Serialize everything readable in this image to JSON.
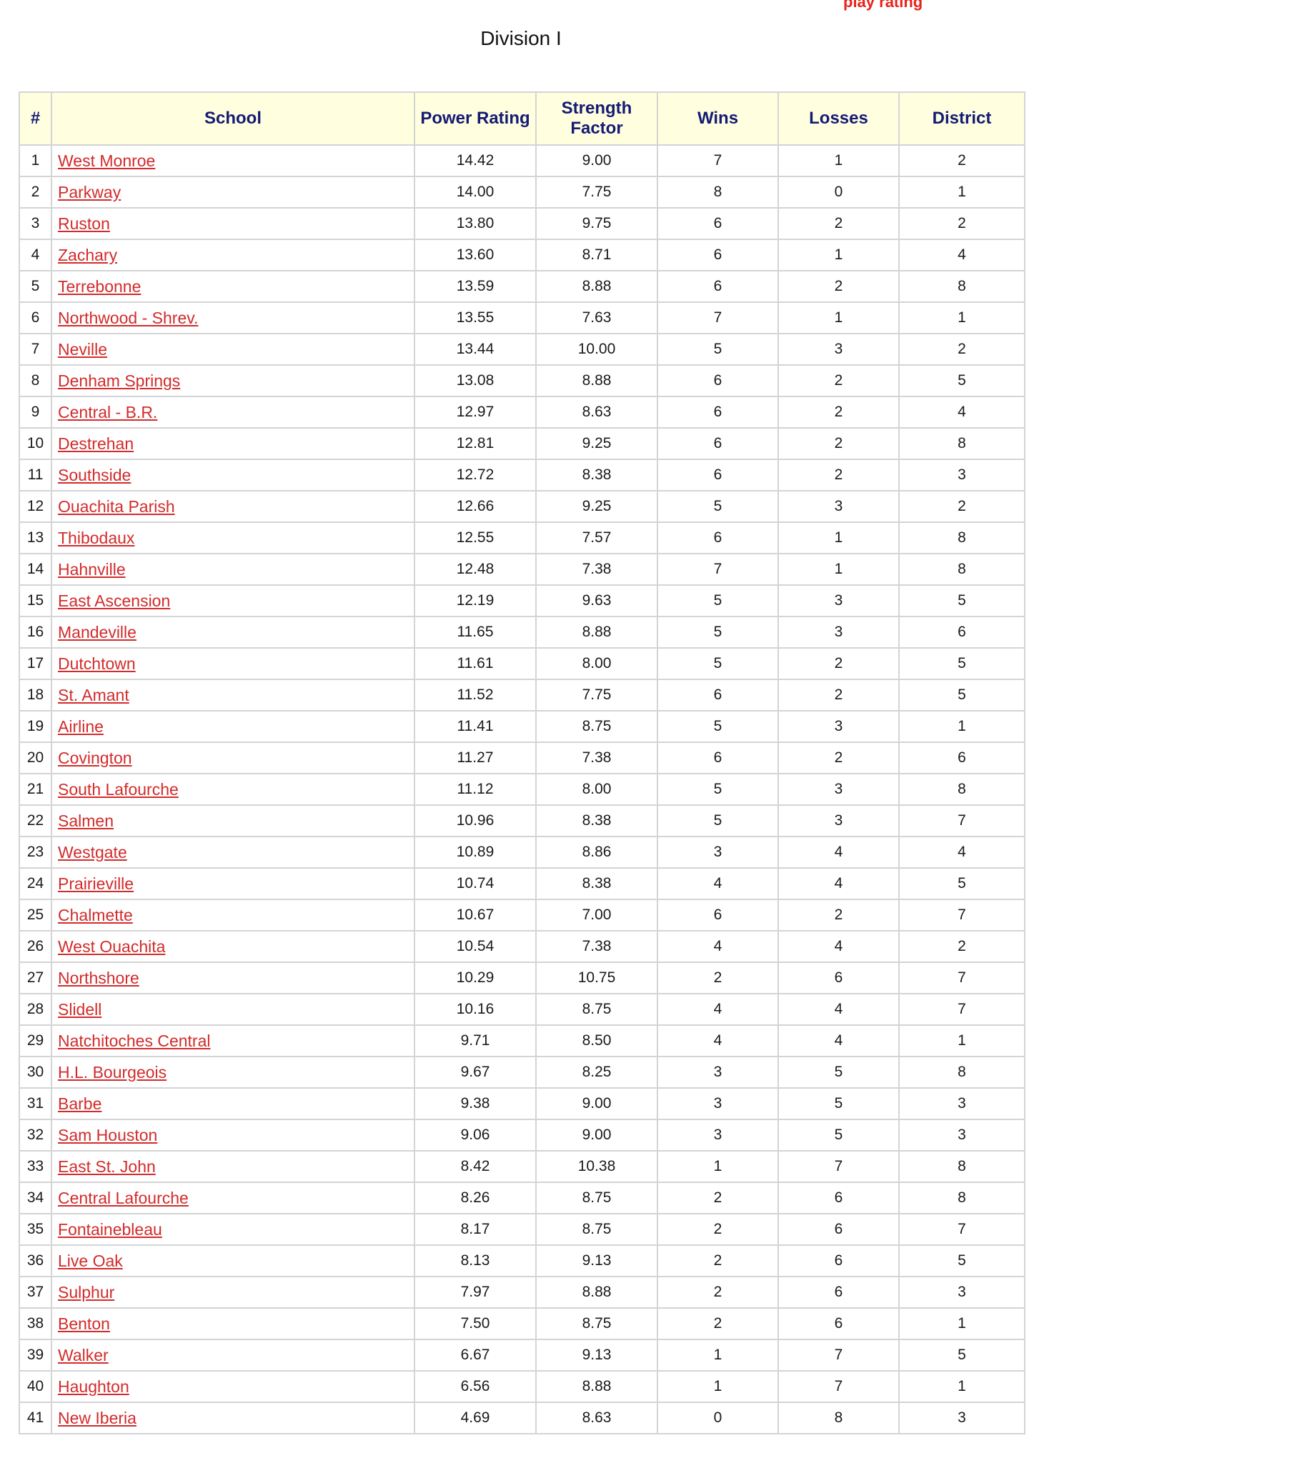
{
  "header": {
    "top_fragment": "play  rating",
    "title": "Division I"
  },
  "table": {
    "columns": {
      "rank": "#",
      "school": "School",
      "power": "Power Rating",
      "strength": "Strength Factor",
      "wins": "Wins",
      "losses": "Losses",
      "district": "District"
    },
    "rows": [
      {
        "rank": "1",
        "school": "West Monroe",
        "power": "14.42",
        "strength": "9.00",
        "wins": "7",
        "losses": "1",
        "district": "2"
      },
      {
        "rank": "2",
        "school": "Parkway",
        "power": "14.00",
        "strength": "7.75",
        "wins": "8",
        "losses": "0",
        "district": "1"
      },
      {
        "rank": "3",
        "school": "Ruston",
        "power": "13.80",
        "strength": "9.75",
        "wins": "6",
        "losses": "2",
        "district": "2"
      },
      {
        "rank": "4",
        "school": "Zachary",
        "power": "13.60",
        "strength": "8.71",
        "wins": "6",
        "losses": "1",
        "district": "4"
      },
      {
        "rank": "5",
        "school": "Terrebonne",
        "power": "13.59",
        "strength": "8.88",
        "wins": "6",
        "losses": "2",
        "district": "8"
      },
      {
        "rank": "6",
        "school": "Northwood - Shrev.",
        "power": "13.55",
        "strength": "7.63",
        "wins": "7",
        "losses": "1",
        "district": "1"
      },
      {
        "rank": "7",
        "school": "Neville",
        "power": "13.44",
        "strength": "10.00",
        "wins": "5",
        "losses": "3",
        "district": "2"
      },
      {
        "rank": "8",
        "school": "Denham Springs",
        "power": "13.08",
        "strength": "8.88",
        "wins": "6",
        "losses": "2",
        "district": "5"
      },
      {
        "rank": "9",
        "school": "Central - B.R.",
        "power": "12.97",
        "strength": "8.63",
        "wins": "6",
        "losses": "2",
        "district": "4"
      },
      {
        "rank": "10",
        "school": "Destrehan",
        "power": "12.81",
        "strength": "9.25",
        "wins": "6",
        "losses": "2",
        "district": "8"
      },
      {
        "rank": "11",
        "school": "Southside",
        "power": "12.72",
        "strength": "8.38",
        "wins": "6",
        "losses": "2",
        "district": "3"
      },
      {
        "rank": "12",
        "school": "Ouachita Parish",
        "power": "12.66",
        "strength": "9.25",
        "wins": "5",
        "losses": "3",
        "district": "2"
      },
      {
        "rank": "13",
        "school": "Thibodaux",
        "power": "12.55",
        "strength": "7.57",
        "wins": "6",
        "losses": "1",
        "district": "8"
      },
      {
        "rank": "14",
        "school": "Hahnville",
        "power": "12.48",
        "strength": "7.38",
        "wins": "7",
        "losses": "1",
        "district": "8"
      },
      {
        "rank": "15",
        "school": "East Ascension",
        "power": "12.19",
        "strength": "9.63",
        "wins": "5",
        "losses": "3",
        "district": "5"
      },
      {
        "rank": "16",
        "school": "Mandeville",
        "power": "11.65",
        "strength": "8.88",
        "wins": "5",
        "losses": "3",
        "district": "6"
      },
      {
        "rank": "17",
        "school": "Dutchtown",
        "power": "11.61",
        "strength": "8.00",
        "wins": "5",
        "losses": "2",
        "district": "5"
      },
      {
        "rank": "18",
        "school": "St. Amant",
        "power": "11.52",
        "strength": "7.75",
        "wins": "6",
        "losses": "2",
        "district": "5"
      },
      {
        "rank": "19",
        "school": "Airline",
        "power": "11.41",
        "strength": "8.75",
        "wins": "5",
        "losses": "3",
        "district": "1"
      },
      {
        "rank": "20",
        "school": "Covington",
        "power": "11.27",
        "strength": "7.38",
        "wins": "6",
        "losses": "2",
        "district": "6"
      },
      {
        "rank": "21",
        "school": "South Lafourche",
        "power": "11.12",
        "strength": "8.00",
        "wins": "5",
        "losses": "3",
        "district": "8"
      },
      {
        "rank": "22",
        "school": "Salmen",
        "power": "10.96",
        "strength": "8.38",
        "wins": "5",
        "losses": "3",
        "district": "7"
      },
      {
        "rank": "23",
        "school": "Westgate",
        "power": "10.89",
        "strength": "8.86",
        "wins": "3",
        "losses": "4",
        "district": "4"
      },
      {
        "rank": "24",
        "school": "Prairieville",
        "power": "10.74",
        "strength": "8.38",
        "wins": "4",
        "losses": "4",
        "district": "5"
      },
      {
        "rank": "25",
        "school": "Chalmette",
        "power": "10.67",
        "strength": "7.00",
        "wins": "6",
        "losses": "2",
        "district": "7"
      },
      {
        "rank": "26",
        "school": "West Ouachita",
        "power": "10.54",
        "strength": "7.38",
        "wins": "4",
        "losses": "4",
        "district": "2"
      },
      {
        "rank": "27",
        "school": "Northshore",
        "power": "10.29",
        "strength": "10.75",
        "wins": "2",
        "losses": "6",
        "district": "7"
      },
      {
        "rank": "28",
        "school": "Slidell",
        "power": "10.16",
        "strength": "8.75",
        "wins": "4",
        "losses": "4",
        "district": "7"
      },
      {
        "rank": "29",
        "school": "Natchitoches Central",
        "power": "9.71",
        "strength": "8.50",
        "wins": "4",
        "losses": "4",
        "district": "1"
      },
      {
        "rank": "30",
        "school": "H.L. Bourgeois",
        "power": "9.67",
        "strength": "8.25",
        "wins": "3",
        "losses": "5",
        "district": "8"
      },
      {
        "rank": "31",
        "school": "Barbe",
        "power": "9.38",
        "strength": "9.00",
        "wins": "3",
        "losses": "5",
        "district": "3"
      },
      {
        "rank": "32",
        "school": "Sam Houston",
        "power": "9.06",
        "strength": "9.00",
        "wins": "3",
        "losses": "5",
        "district": "3"
      },
      {
        "rank": "33",
        "school": "East St. John",
        "power": "8.42",
        "strength": "10.38",
        "wins": "1",
        "losses": "7",
        "district": "8"
      },
      {
        "rank": "34",
        "school": "Central Lafourche",
        "power": "8.26",
        "strength": "8.75",
        "wins": "2",
        "losses": "6",
        "district": "8"
      },
      {
        "rank": "35",
        "school": "Fontainebleau",
        "power": "8.17",
        "strength": "8.75",
        "wins": "2",
        "losses": "6",
        "district": "7"
      },
      {
        "rank": "36",
        "school": "Live Oak",
        "power": "8.13",
        "strength": "9.13",
        "wins": "2",
        "losses": "6",
        "district": "5"
      },
      {
        "rank": "37",
        "school": "Sulphur",
        "power": "7.97",
        "strength": "8.88",
        "wins": "2",
        "losses": "6",
        "district": "3"
      },
      {
        "rank": "38",
        "school": "Benton",
        "power": "7.50",
        "strength": "8.75",
        "wins": "2",
        "losses": "6",
        "district": "1"
      },
      {
        "rank": "39",
        "school": "Walker",
        "power": "6.67",
        "strength": "9.13",
        "wins": "1",
        "losses": "7",
        "district": "5"
      },
      {
        "rank": "40",
        "school": "Haughton",
        "power": "6.56",
        "strength": "8.88",
        "wins": "1",
        "losses": "7",
        "district": "1"
      },
      {
        "rank": "41",
        "school": "New Iberia",
        "power": "4.69",
        "strength": "8.63",
        "wins": "0",
        "losses": "8",
        "district": "3"
      }
    ]
  }
}
